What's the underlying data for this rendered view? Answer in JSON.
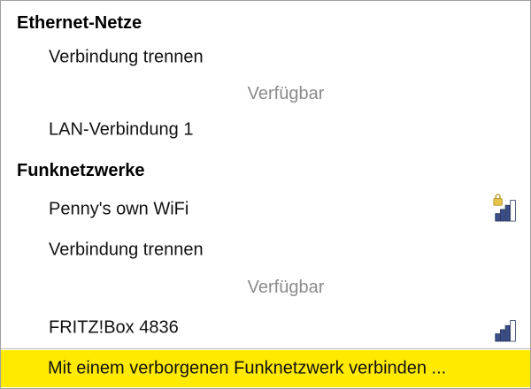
{
  "ethernet": {
    "header": "Ethernet-Netze",
    "disconnect_label": "Verbindung trennen",
    "available_label": "Verfügbar",
    "connections": [
      {
        "label": "LAN-Verbindung 1"
      }
    ]
  },
  "wireless": {
    "header": "Funknetzwerke",
    "connected": {
      "label": "Penny's own WiFi",
      "secured": true,
      "signal_bars": 3,
      "signal_max": 4
    },
    "disconnect_label": "Verbindung trennen",
    "available_label": "Verfügbar",
    "networks": [
      {
        "label": "FRITZ!Box 4836",
        "secured": false,
        "signal_bars": 3,
        "signal_max": 4
      }
    ]
  },
  "hidden_network": {
    "label": "Mit einem verborgenen Funknetzwerk verbinden ..."
  },
  "colors": {
    "highlight": "#ffea00",
    "signal_filled": "#3a4f8a",
    "signal_empty": "#ffffff",
    "lock": "#e3c24a",
    "available_text": "#8a8a8a"
  }
}
